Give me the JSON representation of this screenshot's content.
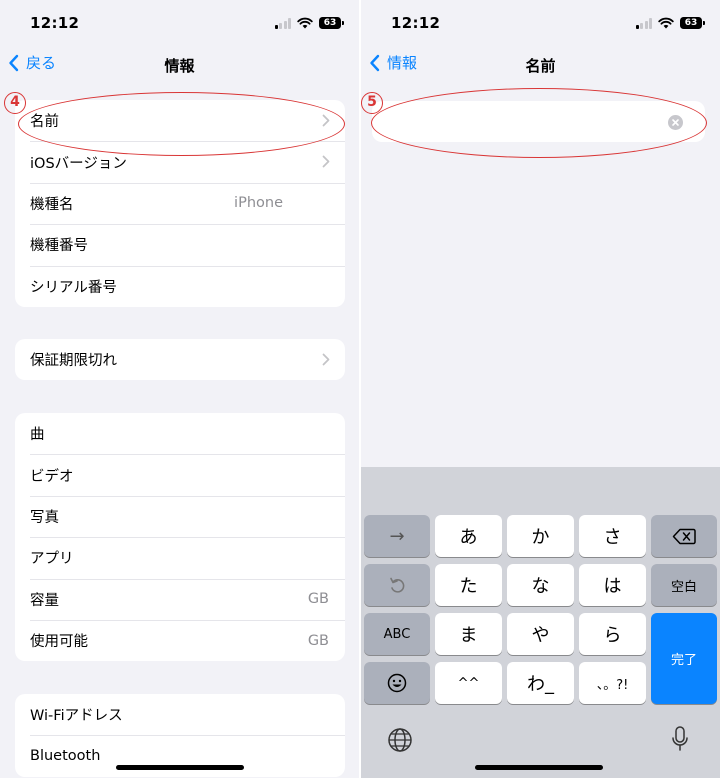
{
  "left": {
    "status": {
      "time": "12:12",
      "battery": "63"
    },
    "nav": {
      "back_label": "戻る",
      "title": "情報"
    },
    "annotation_number": "4",
    "group1": [
      {
        "label": "名前",
        "value": "",
        "chevron": true
      },
      {
        "label": "iOSバージョン",
        "value": "",
        "chevron": true
      },
      {
        "label": "機種名",
        "value": "iPhone",
        "chevron": false
      },
      {
        "label": "機種番号",
        "value": "",
        "chevron": false
      },
      {
        "label": "シリアル番号",
        "value": "",
        "chevron": false
      }
    ],
    "group2": [
      {
        "label": "保証期限切れ",
        "value": "",
        "chevron": true
      }
    ],
    "group3": [
      {
        "label": "曲",
        "value": ""
      },
      {
        "label": "ビデオ",
        "value": ""
      },
      {
        "label": "写真",
        "value": ""
      },
      {
        "label": "アプリ",
        "value": ""
      },
      {
        "label": "容量",
        "value": "GB"
      },
      {
        "label": "使用可能",
        "value": "GB"
      }
    ],
    "group4": [
      {
        "label": "Wi-Fiアドレス",
        "value": ""
      },
      {
        "label": "Bluetooth",
        "value": ""
      }
    ]
  },
  "right": {
    "status": {
      "time": "12:12",
      "battery": "63"
    },
    "nav": {
      "back_label": "情報",
      "title": "名前"
    },
    "annotation_number": "5",
    "name_field": {
      "value": ""
    },
    "keyboard": {
      "arrow": "→",
      "row1": [
        "あ",
        "か",
        "さ"
      ],
      "row2": [
        "た",
        "な",
        "は"
      ],
      "row3": [
        "ま",
        "や",
        "ら"
      ],
      "row4": [
        "^^",
        "わ_",
        "、。?!"
      ],
      "space_label": "空白",
      "abc_label": "ABC",
      "done_label": "完了"
    }
  },
  "colors": {
    "accent": "#0a84ff",
    "annotation": "#d93636",
    "background": "#f2f2f7"
  }
}
